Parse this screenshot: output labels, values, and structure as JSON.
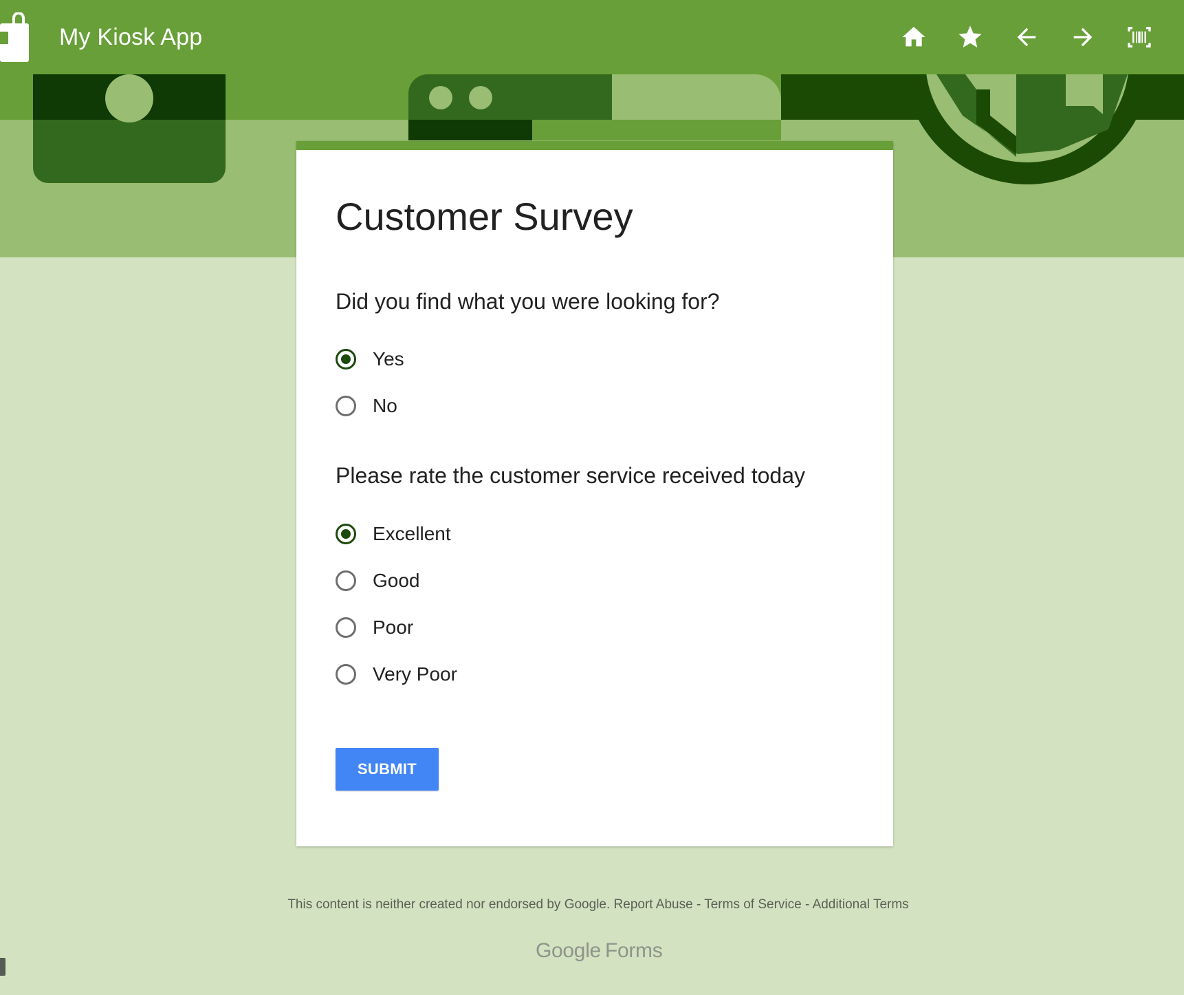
{
  "app": {
    "title": "My Kiosk App"
  },
  "toolbar": {
    "items": [
      {
        "icon": "home-icon"
      },
      {
        "icon": "star-icon"
      },
      {
        "icon": "arrow-back-icon"
      },
      {
        "icon": "arrow-forward-icon"
      },
      {
        "icon": "barcode-scan-icon"
      }
    ]
  },
  "form": {
    "title": "Customer Survey",
    "questions": [
      {
        "text": "Did you find what you were looking for?",
        "options": [
          "Yes",
          "No"
        ],
        "selected": "Yes"
      },
      {
        "text": "Please rate the customer service received today",
        "options": [
          "Excellent",
          "Good",
          "Poor",
          "Very Poor"
        ],
        "selected": "Excellent"
      }
    ],
    "submit_label": "SUBMIT"
  },
  "footer": {
    "disclaimer": "This content is neither created nor endorsed by Google.",
    "report_abuse": "Report Abuse",
    "terms": "Terms of Service",
    "additional_terms": "Additional Terms",
    "separator": "-",
    "brand_google": "Google",
    "brand_forms": "Forms"
  },
  "colors": {
    "appbar": "#689f38",
    "banner": "#99bd72",
    "page_background": "#d3e2c1",
    "radio_checked": "#1b4a0c",
    "submit": "#4285f4"
  }
}
